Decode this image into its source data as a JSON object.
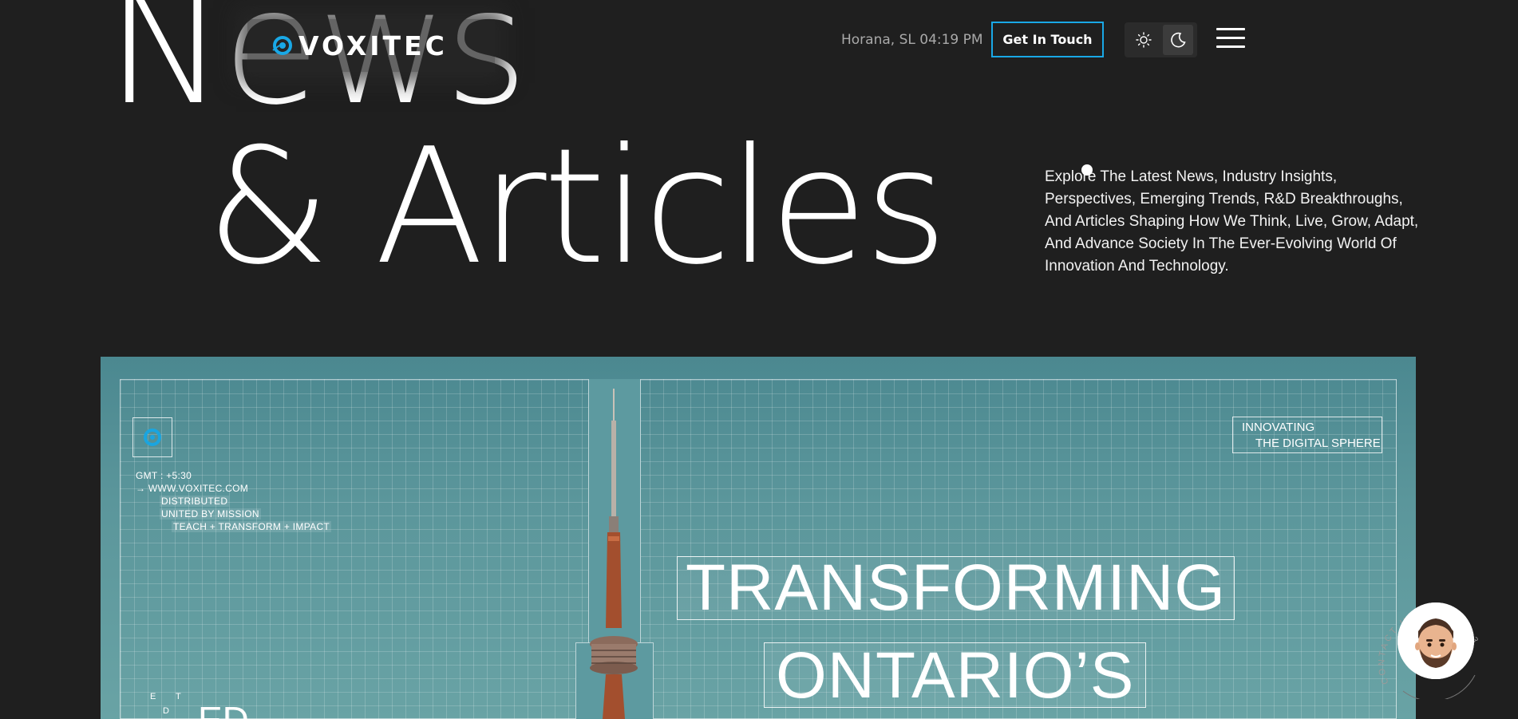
{
  "header": {
    "brand": "VOXITEC",
    "location_time": "Horana, SL 04:19 PM",
    "cta_label": "Get In Touch",
    "theme_options": [
      "light-mode",
      "dark-mode"
    ],
    "theme_active": "dark-mode",
    "menu_icon": "hamburger-icon"
  },
  "hero": {
    "title_line1": "News",
    "title_line2": "& Articles",
    "intro": "Explore The Latest News, Industry Insights, Perspectives, Emerging Trends, R&D Breakthroughs, And Articles Shaping How We Think, Live, Grow, Adapt, And Advance Society In The Ever-Evolving World Of Innovation And Technology."
  },
  "banner": {
    "meta": {
      "gmt": "GMT : +5:30",
      "website": "→ WWW.VOXITEC.COM",
      "line_distributed": "DISTRIBUTED",
      "line_united": "UNITED BY MISSION",
      "line_teach": "TEACH + TRANSFORM + IMPACT"
    },
    "tagline_1": "INNOVATING",
    "tagline_2": "THE DIGITAL SPHERE",
    "headline_1": "TRANSFORMING",
    "headline_2": "ONTARIO’S",
    "fragment_small_1": "E",
    "fragment_small_2": "T",
    "fragment_small_3": "D",
    "fragment_big": "ED"
  },
  "contact": {
    "ring_text": "CONTACT US • +94 74 347 1733"
  },
  "colors": {
    "background": "#1f1f1f",
    "accent": "#19a8e6",
    "banner_teal": "#5b969b"
  }
}
